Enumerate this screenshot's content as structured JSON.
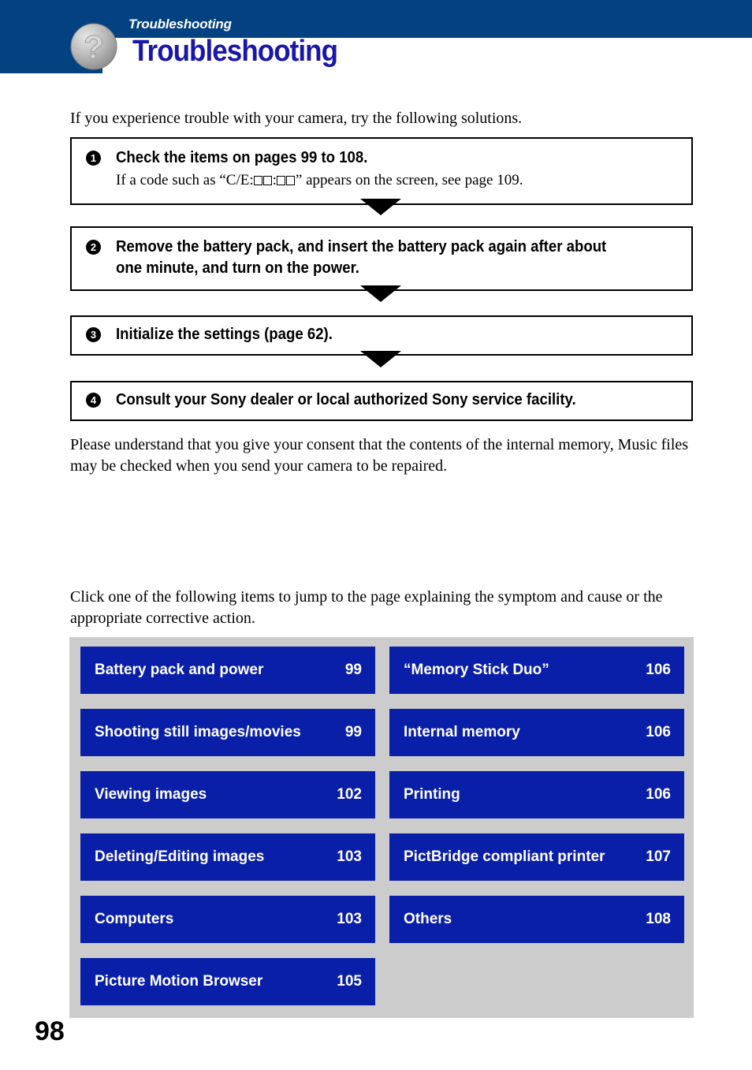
{
  "header": {
    "eyebrow": "Troubleshooting",
    "title": "Troubleshooting",
    "band_color": "#034180",
    "title_color": "#1a17a8",
    "badge_icon": "question-mark-circle-icon"
  },
  "intro": {
    "line": "If you experience trouble with your camera, try the following solutions."
  },
  "steps": [
    {
      "number": "1",
      "heading": "Check the items on pages 99 to 108.",
      "sub_prefix": "If a code such as “C/E:",
      "sub_mid": ":",
      "sub_suffix": "” appears on the screen, see page 109."
    },
    {
      "number": "2",
      "heading": "Remove the battery pack, and insert the battery pack again after about one minute, and turn on the power."
    },
    {
      "number": "3",
      "heading": "Initialize the settings (page 62)."
    },
    {
      "number": "4",
      "heading": "Consult your Sony dealer or local authorized Sony service facility."
    }
  ],
  "consent_paragraph": "Please understand that you give your consent that the contents of the internal memory, Music files may be checked when you send your camera to be repaired.",
  "jump_paragraph": "Click one of the following items to jump to the page explaining the symptom and cause or the appropriate corrective action.",
  "link_panel": {
    "background_color": "#cccccc",
    "button_color": "#0a1fa8",
    "items": [
      {
        "label": "Battery pack and power",
        "page": "99"
      },
      {
        "label": "“Memory Stick Duo”",
        "page": "106"
      },
      {
        "label": "Shooting still images/movies",
        "page": "99"
      },
      {
        "label": "Internal memory",
        "page": "106"
      },
      {
        "label": "Viewing images",
        "page": "102"
      },
      {
        "label": "Printing",
        "page": "106"
      },
      {
        "label": "Deleting/Editing images",
        "page": "103"
      },
      {
        "label": "PictBridge compliant printer",
        "page": "107"
      },
      {
        "label": "Computers",
        "page": "103"
      },
      {
        "label": "Others",
        "page": "108"
      },
      {
        "label": "Picture Motion Browser",
        "page": "105"
      }
    ]
  },
  "page_number": "98"
}
